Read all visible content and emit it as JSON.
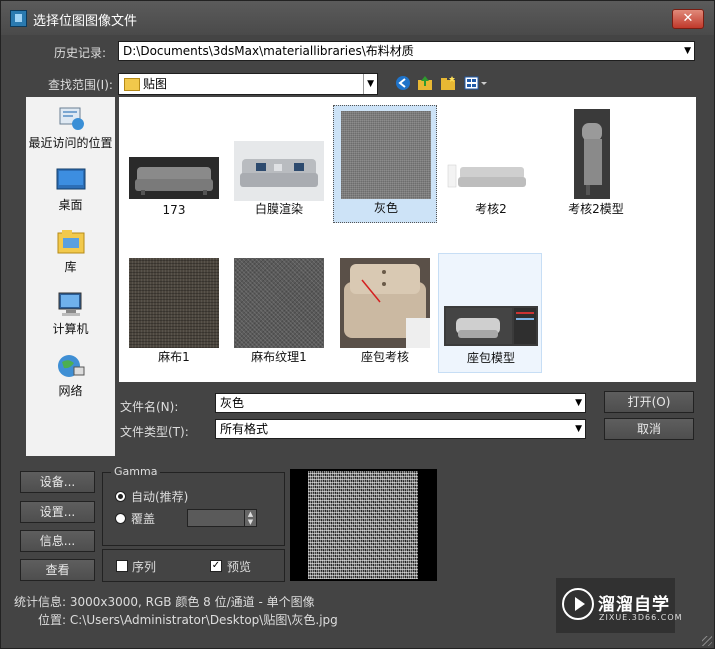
{
  "window": {
    "title": "选择位图图像文件",
    "close_label": "✕"
  },
  "history": {
    "label": "历史记录:",
    "value": "D:\\Documents\\3dsMax\\materiallibraries\\布料材质"
  },
  "lookin": {
    "label": "查找范围(I):",
    "value": "贴图"
  },
  "toolbar": {
    "icons": [
      "back-icon",
      "up-folder-icon",
      "new-folder-icon",
      "view-menu-icon"
    ]
  },
  "places": [
    {
      "label": "最近访问的位置",
      "icon": "recent-places-icon"
    },
    {
      "label": "桌面",
      "icon": "desktop-icon"
    },
    {
      "label": "库",
      "icon": "libraries-icon"
    },
    {
      "label": "计算机",
      "icon": "computer-icon"
    },
    {
      "label": "网络",
      "icon": "network-icon"
    }
  ],
  "files": [
    {
      "name": "173"
    },
    {
      "name": "白膜渲染"
    },
    {
      "name": "灰色",
      "selected": true
    },
    {
      "name": "考核2"
    },
    {
      "name": "考核2模型"
    },
    {
      "name": "麻布1"
    },
    {
      "name": "麻布纹理1"
    },
    {
      "name": "座包考核"
    },
    {
      "name": "座包模型",
      "hovered": true
    }
  ],
  "filename": {
    "label": "文件名(N):",
    "value": "灰色"
  },
  "filetype": {
    "label": "文件类型(T):",
    "value": "所有格式"
  },
  "buttons": {
    "open": "打开(O)",
    "cancel": "取消"
  },
  "side_buttons": {
    "devices": "设备...",
    "setup": "设置...",
    "info": "信息...",
    "view": "查看"
  },
  "gamma": {
    "title": "Gamma",
    "auto_label": "自动(推荐)",
    "override_label": "覆盖",
    "override_value": ""
  },
  "options": {
    "sequence_label": "序列",
    "sequence_checked": false,
    "preview_label": "预览",
    "preview_checked": true
  },
  "status": {
    "stats": "统计信息: 3000x3000, RGB 颜色 8 位/通道 - 单个图像",
    "location": "位置: C:\\Users\\Administrator\\Desktop\\贴图\\灰色.jpg"
  },
  "watermark": {
    "title": "溜溜自学",
    "subtitle": "ZIXUE.3D66.COM"
  }
}
